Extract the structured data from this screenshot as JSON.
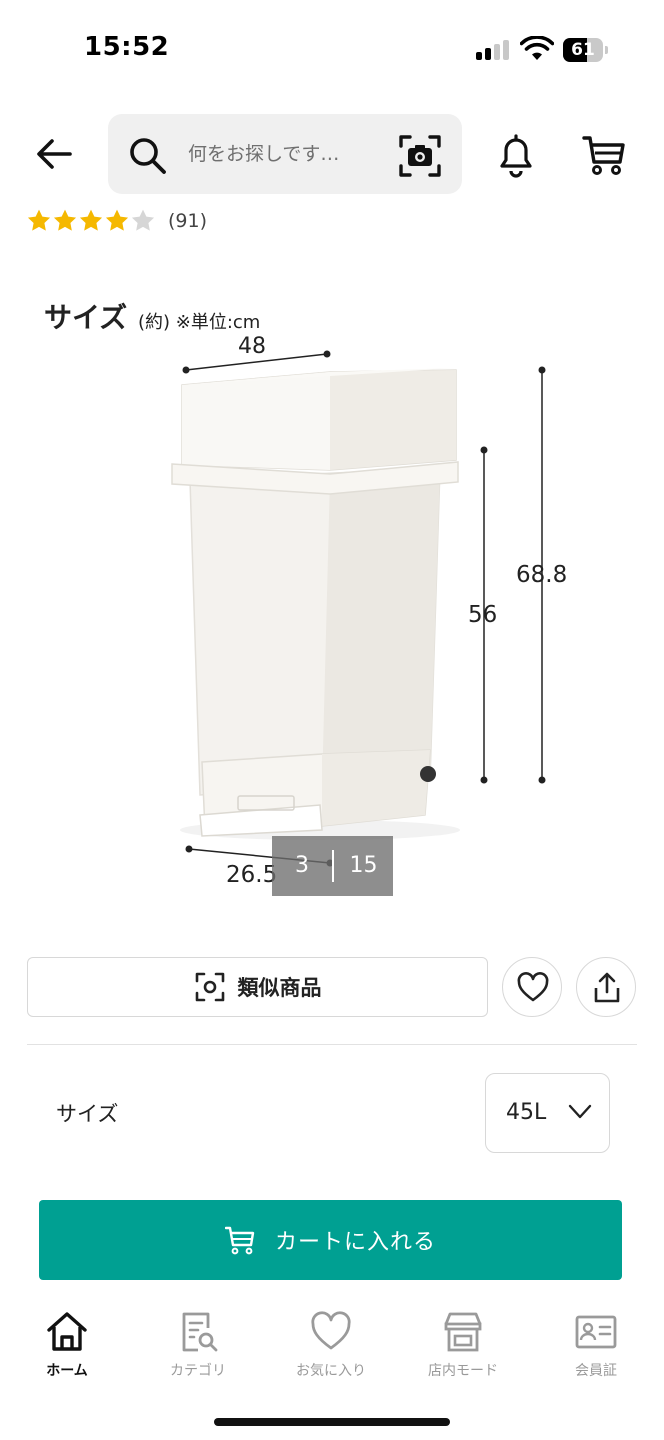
{
  "status_bar": {
    "time": "15:52",
    "battery": "61",
    "battery_level": 0.61
  },
  "header": {
    "search_placeholder": "何をお探しです…",
    "icons": {
      "back": "arrow-left-icon",
      "search": "magnifier-icon",
      "camera": "camera-scan-icon",
      "bell": "bell-icon",
      "cart": "cart-icon"
    }
  },
  "rating": {
    "stars": 4,
    "max_stars": 5,
    "count": "(91)",
    "star_color": "#f5b800",
    "empty_star_color": "#d6d6d6"
  },
  "product_image": {
    "heading": "サイズ",
    "heading_sub": "(約) ※単位:cm",
    "dimensions": {
      "width": "48",
      "total_height": "68.8",
      "body_height": "56",
      "depth": "26.5"
    },
    "page_current": "3",
    "page_total": "15"
  },
  "actions": {
    "similar_label": "類似商品",
    "icons": {
      "similar": "scan-frame-icon",
      "favorite": "heart-icon",
      "share": "share-icon"
    }
  },
  "size_selector": {
    "label": "サイズ",
    "selected": "45L"
  },
  "add_to_cart": {
    "label": "カートに入れる",
    "color": "#00a092"
  },
  "bottom_nav": {
    "items": [
      {
        "label": "ホーム",
        "icon": "home-icon",
        "active": true
      },
      {
        "label": "カテゴリ",
        "icon": "category-search-icon",
        "active": false
      },
      {
        "label": "お気に入り",
        "icon": "heart-icon",
        "active": false
      },
      {
        "label": "店内モード",
        "icon": "store-icon",
        "active": false
      },
      {
        "label": "会員証",
        "icon": "member-card-icon",
        "active": false
      }
    ]
  }
}
